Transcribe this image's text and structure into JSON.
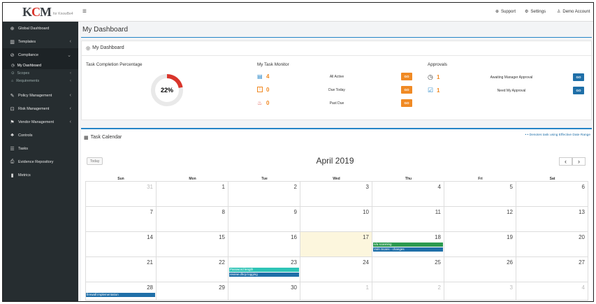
{
  "app": {
    "logo_text": "KCM",
    "logo_sub": "for KnowBe4"
  },
  "sidebar": {
    "items": [
      {
        "label": "Global Dashboard",
        "icon": "globe-icon",
        "glyph": "⊕"
      },
      {
        "label": "Templates",
        "icon": "book-icon",
        "glyph": "▥",
        "chev": "‹"
      },
      {
        "label": "Compliance",
        "icon": "check-circle-icon",
        "glyph": "⊘",
        "chev": "⌄"
      },
      {
        "label": "Policy Management",
        "icon": "edit-icon",
        "glyph": "✎",
        "chev": "‹"
      },
      {
        "label": "Risk Management",
        "icon": "chart-icon",
        "glyph": "⊡",
        "chev": "‹"
      },
      {
        "label": "Vendor Management",
        "icon": "flag-icon",
        "glyph": "⚑",
        "chev": "‹"
      },
      {
        "label": "Controls",
        "icon": "users-icon",
        "glyph": "♣"
      },
      {
        "label": "Tasks",
        "icon": "list-icon",
        "glyph": "☰"
      },
      {
        "label": "Evidence Repository",
        "icon": "file-icon",
        "glyph": "⎙"
      },
      {
        "label": "Metrics",
        "icon": "bar-chart-icon",
        "glyph": "▮"
      }
    ],
    "subitems": [
      {
        "label": "My Dashboard",
        "glyph": "◷"
      },
      {
        "label": "Scopes",
        "glyph": "⊙",
        "chev": "‹"
      },
      {
        "label": "Requirements",
        "glyph": "⌂",
        "chev": "‹"
      }
    ]
  },
  "topbar": {
    "support": "Support",
    "settings": "Settings",
    "user": "Demo Account"
  },
  "page": {
    "title": "My Dashboard",
    "panel_title": "My Dashboard"
  },
  "completion": {
    "title": "Task Completion Percentage",
    "percent_label": "22%",
    "percent": 22,
    "color": "#d9352b"
  },
  "monitor": {
    "title": "My Task Monitor",
    "rows": [
      {
        "count": "4",
        "label": "All Active",
        "go": "GO",
        "icon": "clipboard-icon",
        "glyph": "📋"
      },
      {
        "count": "0",
        "label": "Due Today",
        "go": "GO",
        "icon": "exclamation-icon",
        "glyph": "!"
      },
      {
        "count": "0",
        "label": "Past Due",
        "go": "GO",
        "icon": "fire-icon",
        "glyph": "♨"
      }
    ]
  },
  "approvals": {
    "title": "Approvals",
    "rows": [
      {
        "count": "1",
        "label": "Awaiting Manager Approval",
        "go": "GO",
        "icon": "clock-icon",
        "glyph": "◷"
      },
      {
        "count": "1",
        "label": "Need My Approval",
        "go": "GO",
        "icon": "checkbox-icon",
        "glyph": "☑"
      }
    ]
  },
  "calendar": {
    "title": "Task Calendar",
    "legend": "• • Denotes task using Effective Date Range",
    "today_label": "Today",
    "month": "April 2019",
    "prev": "‹",
    "next": "›",
    "days": [
      "Sun",
      "Mon",
      "Tue",
      "Wed",
      "Thu",
      "Fri",
      "Sat"
    ],
    "weeks": [
      [
        "31",
        "1",
        "2",
        "3",
        "4",
        "5",
        "6"
      ],
      [
        "7",
        "8",
        "9",
        "10",
        "11",
        "12",
        "13"
      ],
      [
        "14",
        "15",
        "16",
        "17",
        "18",
        "19",
        "20"
      ],
      [
        "21",
        "22",
        "23",
        "24",
        "25",
        "26",
        "27"
      ],
      [
        "28",
        "29",
        "30",
        "1",
        "2",
        "3",
        "4"
      ]
    ],
    "events": [
      {
        "label": "n/a scanning",
        "color": "#2b9a4f",
        "week": 2,
        "day": 4
      },
      {
        "label": "Vuln Scans - changes",
        "color": "#1f6fa8",
        "week": 2,
        "day": 4
      },
      {
        "label": "Password length",
        "color": "#2ec4b6",
        "week": 3,
        "day": 2
      },
      {
        "label": "review dhcp logging",
        "color": "#1f6fa8",
        "week": 3,
        "day": 2
      },
      {
        "label": "firewall implementation",
        "color": "#1f6fa8",
        "week": 4,
        "day": 0
      }
    ]
  }
}
